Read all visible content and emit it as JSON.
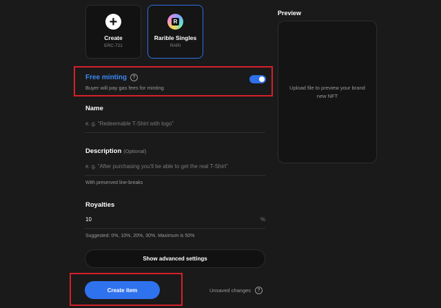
{
  "collections": [
    {
      "title": "Create",
      "subtitle": "ERC-721",
      "icon": "plus-icon"
    },
    {
      "title": "Rarible Singles",
      "subtitle": "RARI",
      "icon": "rarible-logo-icon",
      "icon_letter": "R"
    }
  ],
  "free_minting": {
    "title": "Free minting",
    "help": "?",
    "description": "Buyer will pay gas fees for minting",
    "enabled": true
  },
  "name": {
    "label": "Name",
    "placeholder": "e. g. “Redeemable T-Shirt with logo”"
  },
  "description": {
    "label": "Description",
    "optional": "(Optional)",
    "placeholder": "e. g. “After purchasing you'll be able to get the real T-Shirt”",
    "hint": "With preserved line-breaks"
  },
  "royalties": {
    "label": "Royalties",
    "value": "10",
    "unit": "%",
    "hint": "Suggested: 0%, 10%, 20%, 30%. Maximum is 50%"
  },
  "advanced_button": "Show advanced settings",
  "create_button": "Create item",
  "unsaved": {
    "text": "Unsaved changes",
    "help": "?"
  },
  "preview": {
    "label": "Preview",
    "text": "Upload file to preview your brand new NFT"
  },
  "colors": {
    "accent": "#2f72ee",
    "highlight_box": "#d7202a",
    "background": "#1a1a1a"
  }
}
